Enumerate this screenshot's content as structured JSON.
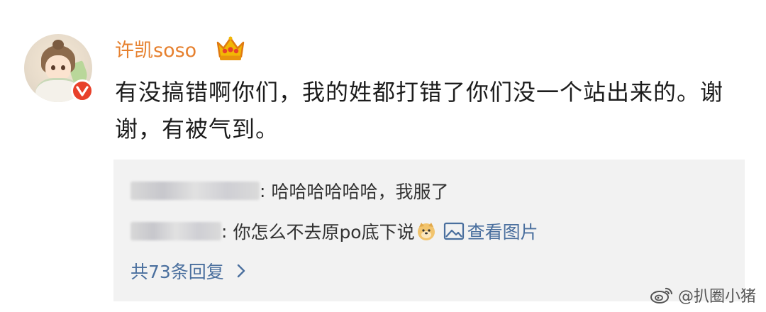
{
  "post": {
    "username": "许凯soso",
    "text": "有没搞错啊你们，我的姓都打错了你们没一个站出来的。谢谢，有被气到。"
  },
  "icons": {
    "avatar": "avatar-illustration",
    "verified": "verified-v-badge-icon",
    "crown": "crown-icon",
    "emoji": "doge-emoji-icon",
    "picture": "picture-icon",
    "chevron": "chevron-right-icon",
    "watermark": "weibo-logo-icon"
  },
  "replies": [
    {
      "text": "哈哈哈哈哈哈，我服了"
    },
    {
      "text": "你怎么不去原po底下说",
      "link_label": "查看图片"
    }
  ],
  "reply_colon": ":",
  "total_replies": "共73条回复",
  "watermark": "@扒圈小猪",
  "colors": {
    "username": "#e6802e",
    "link": "#4a6f9e",
    "reply_bg": "#f2f2f2",
    "verified": "#e8402a"
  }
}
